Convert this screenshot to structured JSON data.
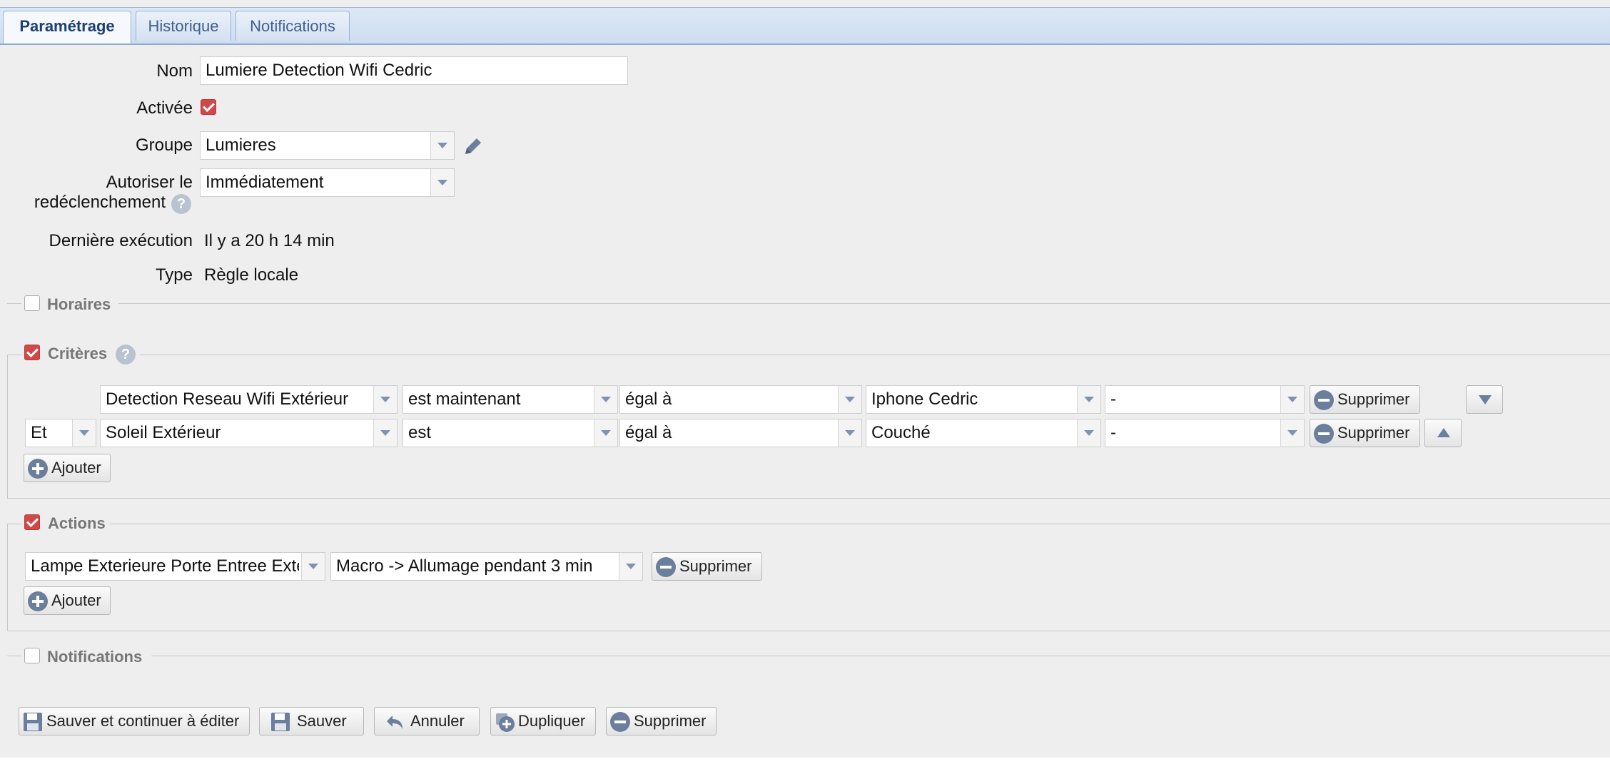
{
  "tabs": [
    {
      "label": "Paramétrage"
    },
    {
      "label": "Historique"
    },
    {
      "label": "Notifications"
    }
  ],
  "form": {
    "nom_label": "Nom",
    "nom_value": "Lumiere Detection Wifi Cedric",
    "activee_label": "Activée",
    "groupe_label": "Groupe",
    "groupe_value": "Lumieres",
    "autoriser_label_1": "Autoriser le",
    "autoriser_label_2": "redéclenchement",
    "autoriser_value": "Immédiatement",
    "derniere_label": "Dernière exécution",
    "derniere_value": "Il y a 20 h 14 min",
    "type_label": "Type",
    "type_value": "Règle locale"
  },
  "sections": {
    "horaires": "Horaires",
    "criteres": "Critères",
    "actions": "Actions",
    "notifications": "Notifications"
  },
  "criteria": [
    {
      "device": "Detection Reseau Wifi Extérieur",
      "state": "est maintenant",
      "operator": "égal à",
      "value": "Iphone Cedric",
      "extra": "-"
    },
    {
      "connector": "Et",
      "device": "Soleil Extérieur",
      "state": "est",
      "operator": "égal à",
      "value": "Couché",
      "extra": "-"
    }
  ],
  "actions": [
    {
      "device": "Lampe Exterieure Porte Entree Exte",
      "command": "Macro -> Allumage pendant 3 min"
    }
  ],
  "buttons": {
    "supprimer": "Supprimer",
    "ajouter": "Ajouter",
    "save_continue": "Sauver et continuer à éditer",
    "save": "Sauver",
    "cancel": "Annuler",
    "duplicate": "Dupliquer",
    "delete": "Supprimer"
  },
  "help_glyph": "?",
  "colors": {
    "accent": "#d04848",
    "tab_text": "#1d3f72",
    "icon": "#6b7f9c"
  }
}
